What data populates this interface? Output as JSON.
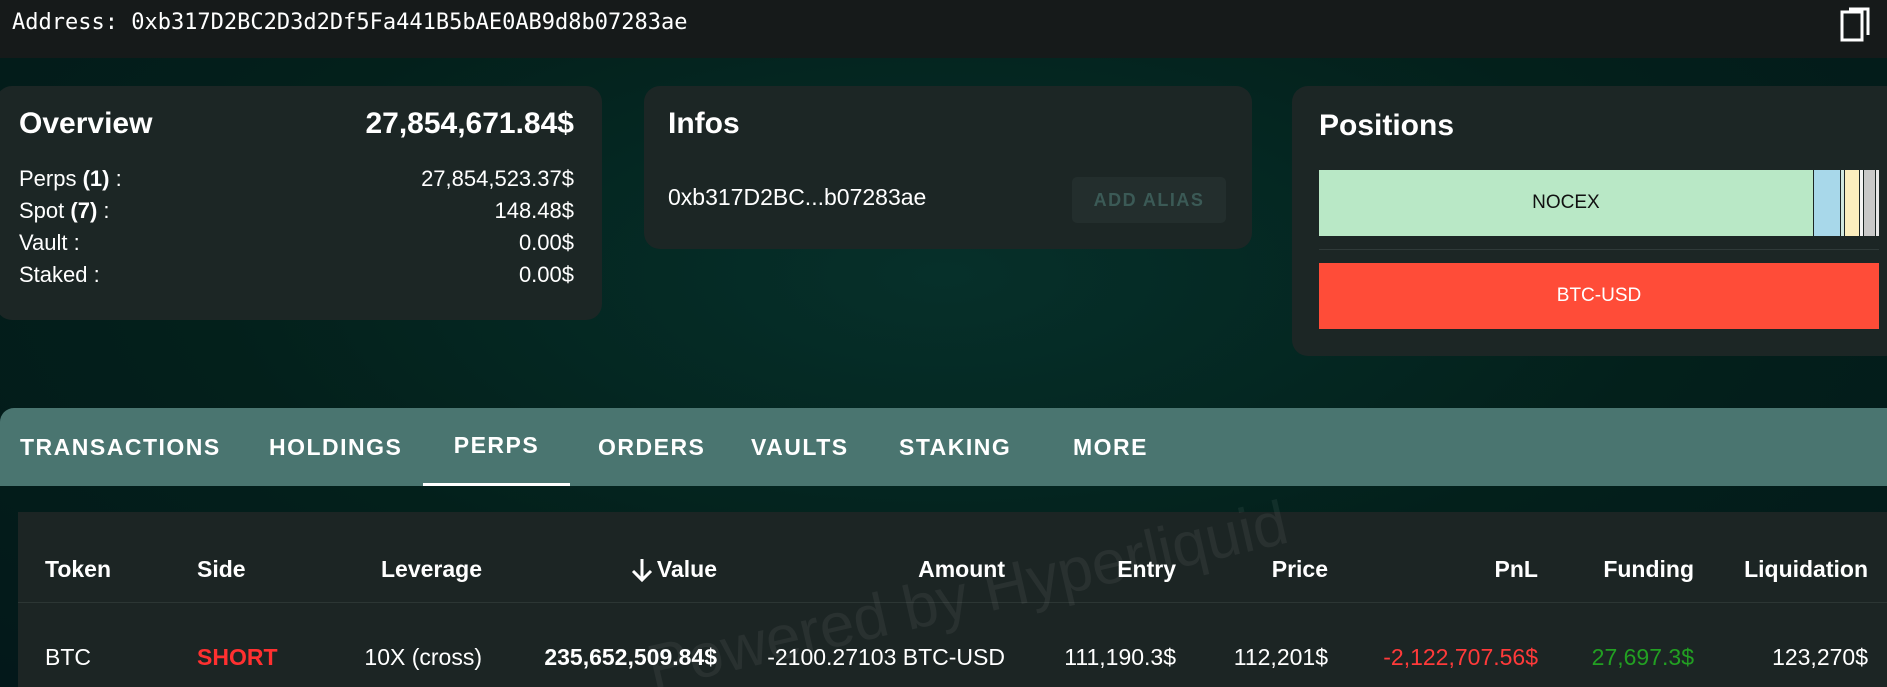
{
  "address_bar": {
    "text": "Address:  0xb317D2BC2D3d2Df5Fa441B5bAE0AB9d8b07283ae",
    "copy_icon": "copy-icon"
  },
  "overview": {
    "title": "Overview",
    "total": "27,854,671.84$",
    "rows": [
      {
        "label": "Perps",
        "count": "(1)",
        "suffix": " :",
        "value": "27,854,523.37$"
      },
      {
        "label": "Spot",
        "count": "(7)",
        "suffix": " :",
        "value": "148.48$"
      },
      {
        "label": "Vault :",
        "count": "",
        "suffix": "",
        "value": "0.00$"
      },
      {
        "label": "Staked :",
        "count": "",
        "suffix": "",
        "value": "0.00$"
      }
    ]
  },
  "infos": {
    "title": "Infos",
    "short_address": "0xb317D2BC...b07283ae",
    "add_alias_label": "ADD ALIAS"
  },
  "positions": {
    "title": "Positions",
    "bar_label": "NOCEX",
    "segments": [
      {
        "share": 0.74,
        "color": "#b9e8c6"
      },
      {
        "share": 0.04,
        "color": "#a8d8ea"
      },
      {
        "share": 0.006,
        "color": "#d0e8e0"
      },
      {
        "share": 0.023,
        "color": "#fbeebe"
      },
      {
        "share": 0.006,
        "color": "#f4f4f4"
      },
      {
        "share": 0.018,
        "color": "#c8c8c8"
      },
      {
        "share": 0.006,
        "color": "#e8e8e8"
      }
    ],
    "btc_label": "BTC-USD",
    "btc_color": "#ff4c38"
  },
  "tabs": [
    {
      "label": "TRANSACTIONS",
      "active": false
    },
    {
      "label": "HOLDINGS",
      "active": false
    },
    {
      "label": "PERPS",
      "active": true
    },
    {
      "label": "ORDERS",
      "active": false
    },
    {
      "label": "VAULTS",
      "active": false
    },
    {
      "label": "STAKING",
      "active": false
    },
    {
      "label": "MORE",
      "active": false
    }
  ],
  "table": {
    "headers": {
      "token": "Token",
      "side": "Side",
      "leverage": "Leverage",
      "value": "Value",
      "amount": "Amount",
      "entry": "Entry",
      "price": "Price",
      "pnl": "PnL",
      "funding": "Funding",
      "liquidation": "Liquidation"
    },
    "sort_icon": "arrow-down-icon",
    "rows": [
      {
        "token": "BTC",
        "side": "SHORT",
        "leverage": "10X (cross)",
        "value": "235,652,509.84$",
        "amount": "-2100.27103 BTC-USD",
        "entry": "111,190.3$",
        "price": "112,201$",
        "pnl": "-2,122,707.56$",
        "funding": "27,697.3$",
        "liquidation": "123,270$"
      }
    ],
    "watermark": "Powered by Hyperliquid"
  },
  "colors": {
    "background": "#03201b",
    "card": "#1c2625",
    "tab_bar": "#4a7570",
    "short": "#ff3030",
    "pnl_negative": "#ff3a3a",
    "funding_positive": "#22a022"
  }
}
